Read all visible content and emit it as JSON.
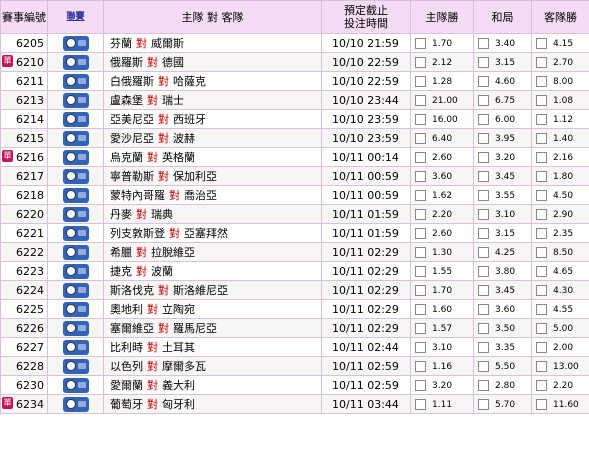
{
  "headers": {
    "match_no": "賽事編號",
    "league": "聯賽",
    "teams": "主隊 對 客隊",
    "time_line1": "預定截止",
    "time_line2": "投注時間",
    "home": "主隊勝",
    "draw": "和局",
    "away": "客隊勝"
  },
  "vs_label": "對",
  "single_label": "單",
  "league_icon": "football-league-icon",
  "rows": [
    {
      "no": "6205",
      "single": false,
      "home": "芬蘭",
      "away": "威爾斯",
      "time": "10/10 21:59",
      "h": "1.70",
      "d": "3.40",
      "a": "4.15"
    },
    {
      "no": "6210",
      "single": true,
      "home": "俄羅斯",
      "away": "德國",
      "time": "10/10 22:59",
      "h": "2.12",
      "d": "3.15",
      "a": "2.70"
    },
    {
      "no": "6211",
      "single": false,
      "home": "白俄羅斯",
      "away": "哈薩克",
      "time": "10/10 22:59",
      "h": "1.28",
      "d": "4.60",
      "a": "8.00"
    },
    {
      "no": "6213",
      "single": false,
      "home": "盧森堡",
      "away": "瑞士",
      "time": "10/10 23:44",
      "h": "21.00",
      "d": "6.75",
      "a": "1.08"
    },
    {
      "no": "6214",
      "single": false,
      "home": "亞美尼亞",
      "away": "西班牙",
      "time": "10/10 23:59",
      "h": "16.00",
      "d": "6.00",
      "a": "1.12"
    },
    {
      "no": "6215",
      "single": false,
      "home": "愛沙尼亞",
      "away": "波赫",
      "time": "10/10 23:59",
      "h": "6.40",
      "d": "3.95",
      "a": "1.40"
    },
    {
      "no": "6216",
      "single": true,
      "home": "烏克蘭",
      "away": "英格蘭",
      "time": "10/11 00:14",
      "h": "2.60",
      "d": "3.20",
      "a": "2.16"
    },
    {
      "no": "6217",
      "single": false,
      "home": "寧普勒斯",
      "away": "保加利亞",
      "time": "10/11 00:59",
      "h": "3.60",
      "d": "3.45",
      "a": "1.80"
    },
    {
      "no": "6218",
      "single": false,
      "home": "蒙特內哥羅",
      "away": "喬治亞",
      "time": "10/11 00:59",
      "h": "1.62",
      "d": "3.55",
      "a": "4.50"
    },
    {
      "no": "6220",
      "single": false,
      "home": "丹麥",
      "away": "瑞典",
      "time": "10/11 01:59",
      "h": "2.20",
      "d": "3.10",
      "a": "2.90"
    },
    {
      "no": "6221",
      "single": false,
      "home": "列支敦斯登",
      "away": "亞塞拜然",
      "time": "10/11 01:59",
      "h": "2.60",
      "d": "3.15",
      "a": "2.35"
    },
    {
      "no": "6222",
      "single": false,
      "home": "希臘",
      "away": "拉脫維亞",
      "time": "10/11 02:29",
      "h": "1.30",
      "d": "4.25",
      "a": "8.50"
    },
    {
      "no": "6223",
      "single": false,
      "home": "捷克",
      "away": "波蘭",
      "time": "10/11 02:29",
      "h": "1.55",
      "d": "3.80",
      "a": "4.65"
    },
    {
      "no": "6224",
      "single": false,
      "home": "斯洛伐克",
      "away": "斯洛維尼亞",
      "time": "10/11 02:29",
      "h": "1.70",
      "d": "3.45",
      "a": "4.30"
    },
    {
      "no": "6225",
      "single": false,
      "home": "奧地利",
      "away": "立陶宛",
      "time": "10/11 02:29",
      "h": "1.60",
      "d": "3.60",
      "a": "4.55"
    },
    {
      "no": "6226",
      "single": false,
      "home": "塞爾維亞",
      "away": "羅馬尼亞",
      "time": "10/11 02:29",
      "h": "1.57",
      "d": "3.50",
      "a": "5.00"
    },
    {
      "no": "6227",
      "single": false,
      "home": "比利時",
      "away": "土耳其",
      "time": "10/11 02:44",
      "h": "3.10",
      "d": "3.35",
      "a": "2.00"
    },
    {
      "no": "6228",
      "single": false,
      "home": "以色列",
      "away": "摩爾多瓦",
      "time": "10/11 02:59",
      "h": "1.16",
      "d": "5.50",
      "a": "13.00"
    },
    {
      "no": "6230",
      "single": false,
      "home": "愛爾蘭",
      "away": "義大利",
      "time": "10/11 02:59",
      "h": "3.20",
      "d": "2.80",
      "a": "2.20"
    },
    {
      "no": "6234",
      "single": true,
      "home": "葡萄牙",
      "away": "匈牙利",
      "time": "10/11 03:44",
      "h": "1.11",
      "d": "5.70",
      "a": "11.60"
    }
  ]
}
